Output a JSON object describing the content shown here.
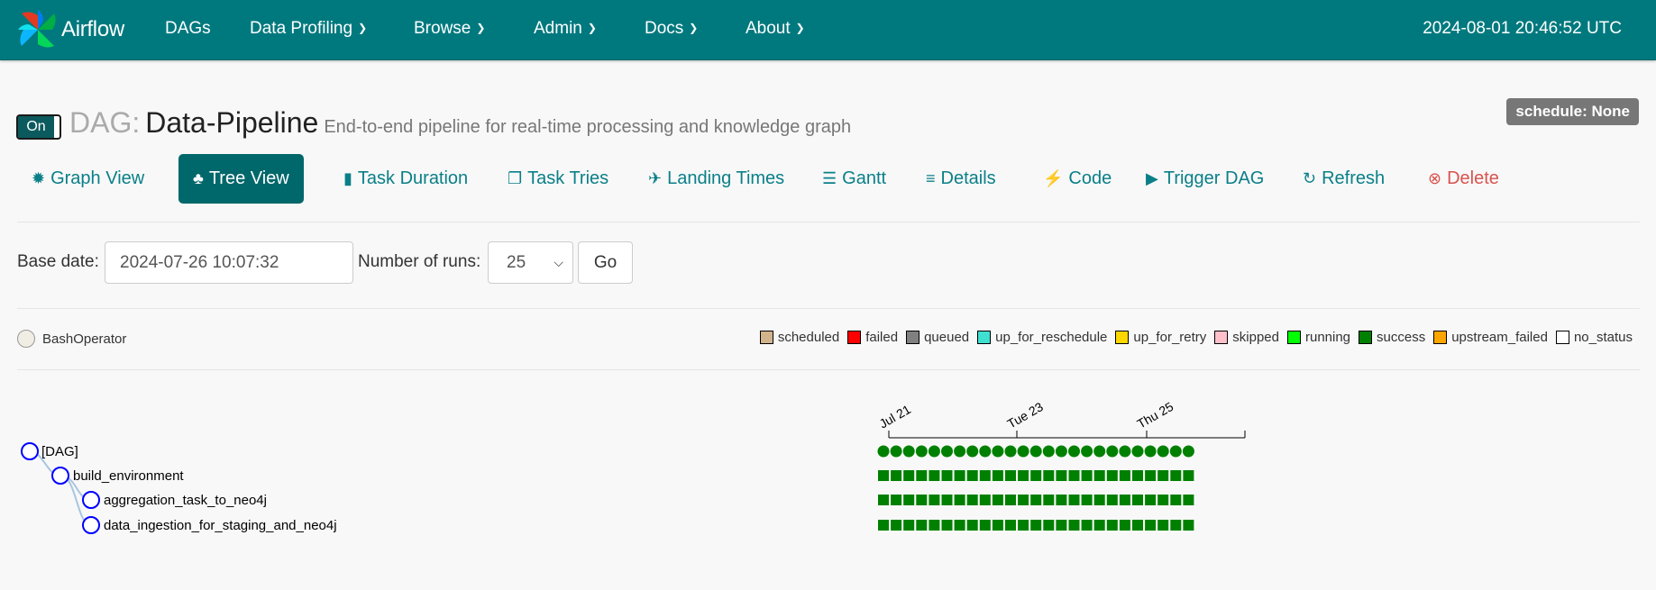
{
  "navbar": {
    "brand": "Airflow",
    "items": [
      "DAGs",
      "Data Profiling",
      "Browse",
      "Admin",
      "Docs",
      "About"
    ],
    "time": "2024-08-01 20:46:52 UTC"
  },
  "dag": {
    "toggle_label": "On",
    "prefix": "DAG:",
    "name": "Data-Pipeline",
    "description": "End-to-end pipeline for real-time processing and knowledge graph",
    "schedule": "schedule: None"
  },
  "tabs": [
    {
      "label": "Graph View",
      "icon": "sun-icon"
    },
    {
      "label": "Tree View",
      "icon": "tree-icon",
      "active": true
    },
    {
      "label": "Task Duration",
      "icon": "bar-chart-icon"
    },
    {
      "label": "Task Tries",
      "icon": "duplicate-icon"
    },
    {
      "label": "Landing Times",
      "icon": "plane-icon"
    },
    {
      "label": "Gantt",
      "icon": "gantt-icon"
    },
    {
      "label": "Details",
      "icon": "list-icon"
    },
    {
      "label": "Code",
      "icon": "flash-icon"
    },
    {
      "label": "Trigger DAG",
      "icon": "play-circle-icon"
    },
    {
      "label": "Refresh",
      "icon": "refresh-icon"
    },
    {
      "label": "Delete",
      "icon": "remove-circle-icon"
    }
  ],
  "form": {
    "base_date_label": "Base date:",
    "base_date_value": "2024-07-26 10:07:32",
    "num_runs_label": "Number of runs:",
    "num_runs_value": "25",
    "go_label": "Go"
  },
  "operator_legend": {
    "label": "BashOperator",
    "color": "#f0ede4"
  },
  "state_legend": [
    {
      "label": "scheduled",
      "color": "#d2b48c"
    },
    {
      "label": "failed",
      "color": "#ff0000"
    },
    {
      "label": "queued",
      "color": "#808080"
    },
    {
      "label": "up_for_reschedule",
      "color": "#40e0d0"
    },
    {
      "label": "up_for_retry",
      "color": "#ffd700"
    },
    {
      "label": "skipped",
      "color": "#ffc0cb"
    },
    {
      "label": "running",
      "color": "#00ff00"
    },
    {
      "label": "success",
      "color": "#008000"
    },
    {
      "label": "upstream_failed",
      "color": "#ffa500"
    },
    {
      "label": "no_status",
      "color": "#ffffff"
    }
  ],
  "tree": {
    "nodes": [
      "[DAG]",
      "build_environment",
      "aggregation_task_to_neo4j",
      "data_ingestion_for_staging_and_neo4j"
    ],
    "axis_ticks": [
      "Jul 21",
      "Tue 23",
      "Thu 25"
    ],
    "num_runs": 25,
    "run_state": "success",
    "colors": {
      "success": "#008000",
      "node_stroke": "#0000ff",
      "link": "#a8c6e0"
    }
  }
}
